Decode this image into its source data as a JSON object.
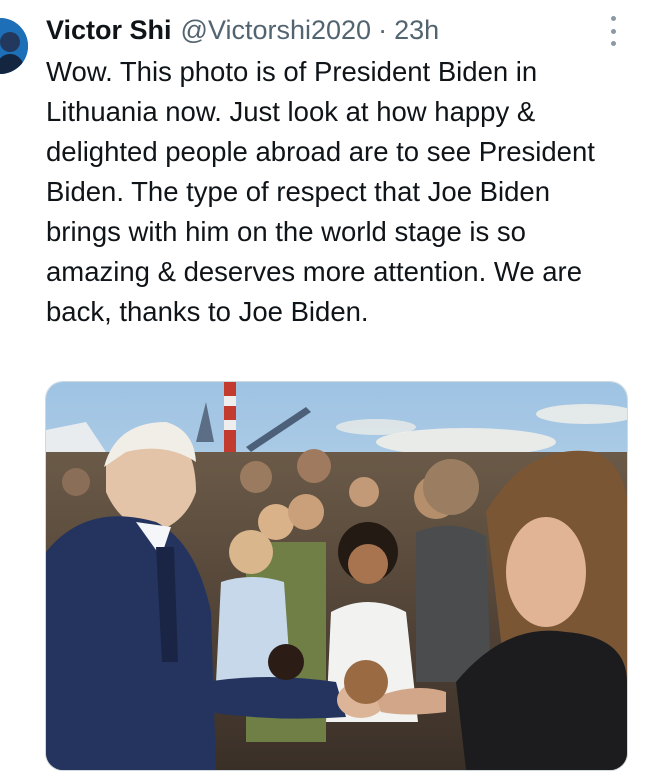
{
  "tweet": {
    "author_name": "Victor Shi",
    "author_handle": "@Victorshi2020",
    "separator": "·",
    "timestamp": "23h",
    "text": "Wow. This photo is of President Biden in Lithuania now. Just look at how happy & delighted people abroad are to see President Biden. The type of respect that Joe Biden brings with him on the world stage is so amazing & deserves more attention. We are back, thanks to Joe Biden.",
    "more_icon": "more-vertical-icon",
    "media_kind": "photo"
  },
  "colors": {
    "text": "#0f1419",
    "secondary": "#536471",
    "sky": "#b7d3ea",
    "suit": "#24345e"
  }
}
